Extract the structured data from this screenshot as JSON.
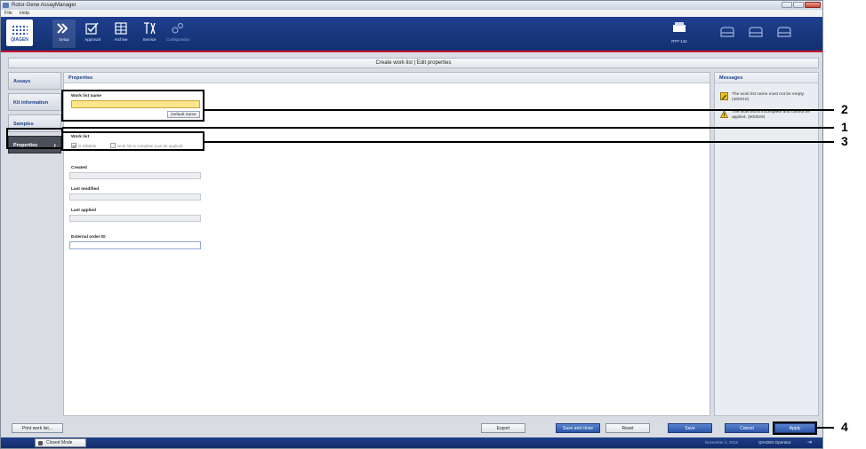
{
  "window": {
    "title": "Rotor-Gene AssayManager"
  },
  "menu": [
    "File",
    "Help"
  ],
  "logo": {
    "text": "QIAGEN"
  },
  "toolbar": {
    "items": [
      {
        "label": "Setup",
        "icon": "setup-arrows-icon",
        "active": true
      },
      {
        "label": "Approval",
        "icon": "approval-check-icon"
      },
      {
        "label": "Archive",
        "icon": "archive-icon"
      },
      {
        "label": "Service",
        "icon": "service-tools-icon"
      },
      {
        "label": "Configuration",
        "icon": "configuration-gears-icon",
        "dim": true
      }
    ],
    "cycler_label": "RTP 142"
  },
  "header": {
    "title": "Create work list | Edit properties"
  },
  "nav": [
    {
      "label": "Assays"
    },
    {
      "label": "Kit information"
    },
    {
      "label": "Samples"
    },
    {
      "label": "Properties",
      "active": true
    }
  ],
  "properties": {
    "title": "Properties",
    "worklist_name_label": "Work list name",
    "worklist_name_value": "",
    "default_name_button": "Default name",
    "worklist_label": "Work list",
    "is_editable_label": "is editable",
    "is_complete_label": "work list is complete (can be applied)",
    "created_label": "Created",
    "last_modified_label": "Last modified",
    "last_applied_label": "Last applied",
    "external_order_label": "External order ID"
  },
  "messages": {
    "title": "Messages",
    "items": [
      {
        "icon": "edit-pencil-icon",
        "text": "The work list name must not be empty. (460010)"
      },
      {
        "icon": "warning-triangle-icon",
        "text": "The work list is incomplete and cannot be applied. (900029)"
      }
    ]
  },
  "buttons": {
    "print": "Print work list...",
    "export": "Export",
    "save_and_close": "Save and close",
    "reset": "Reset",
    "save": "Save",
    "cancel": "Cancel",
    "apply": "Apply"
  },
  "status": {
    "mode": "Closed Mode",
    "date": "November 2, 2016",
    "user": "QIAGEN Operator"
  },
  "callouts": [
    "2",
    "1",
    "3",
    "4"
  ],
  "colors": {
    "accent": "#1f3f8f",
    "highlight_field": "#fde58c",
    "stripe": "#c8102e"
  }
}
